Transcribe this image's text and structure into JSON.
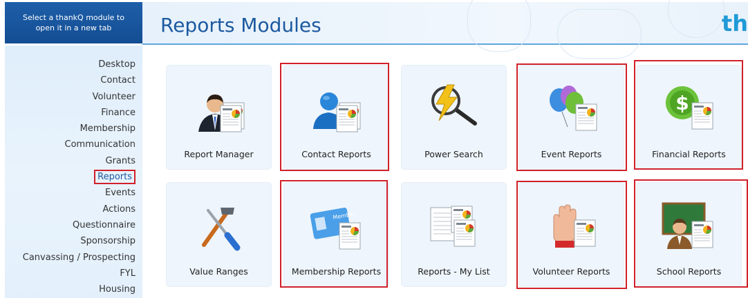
{
  "module_hint": "Select a thankQ module to open it in a new tab",
  "page_title": "Reports Modules",
  "brand_fragment": "th",
  "sidebar": {
    "items": [
      {
        "label": "Desktop"
      },
      {
        "label": "Contact"
      },
      {
        "label": "Volunteer"
      },
      {
        "label": "Finance"
      },
      {
        "label": "Membership"
      },
      {
        "label": "Communication"
      },
      {
        "label": "Grants"
      },
      {
        "label": "Reports",
        "active": true
      },
      {
        "label": "Events"
      },
      {
        "label": "Actions"
      },
      {
        "label": "Questionnaire"
      },
      {
        "label": "Sponsorship"
      },
      {
        "label": "Canvassing / Prospecting"
      },
      {
        "label": "FYL"
      },
      {
        "label": "Housing"
      }
    ]
  },
  "tiles": [
    {
      "label": "Report Manager",
      "icon": "report-manager-icon",
      "highlighted": false
    },
    {
      "label": "Contact Reports",
      "icon": "contact-reports-icon",
      "highlighted": true
    },
    {
      "label": "Power Search",
      "icon": "power-search-icon",
      "highlighted": false
    },
    {
      "label": "Event Reports",
      "icon": "event-reports-icon",
      "highlighted": true
    },
    {
      "label": "Financial Reports",
      "icon": "financial-reports-icon",
      "highlighted": true
    },
    {
      "label": "Value Ranges",
      "icon": "value-ranges-icon",
      "highlighted": false
    },
    {
      "label": "Membership Reports",
      "icon": "membership-reports-icon",
      "highlighted": true
    },
    {
      "label": "Reports - My List",
      "icon": "reports-my-list-icon",
      "highlighted": false
    },
    {
      "label": "Volunteer Reports",
      "icon": "volunteer-reports-icon",
      "highlighted": true
    },
    {
      "label": "School Reports",
      "icon": "school-reports-icon",
      "highlighted": true
    }
  ],
  "colors": {
    "accent": "#1c5aa0",
    "highlight": "#d1202a",
    "brand": "#1f9ad6"
  }
}
